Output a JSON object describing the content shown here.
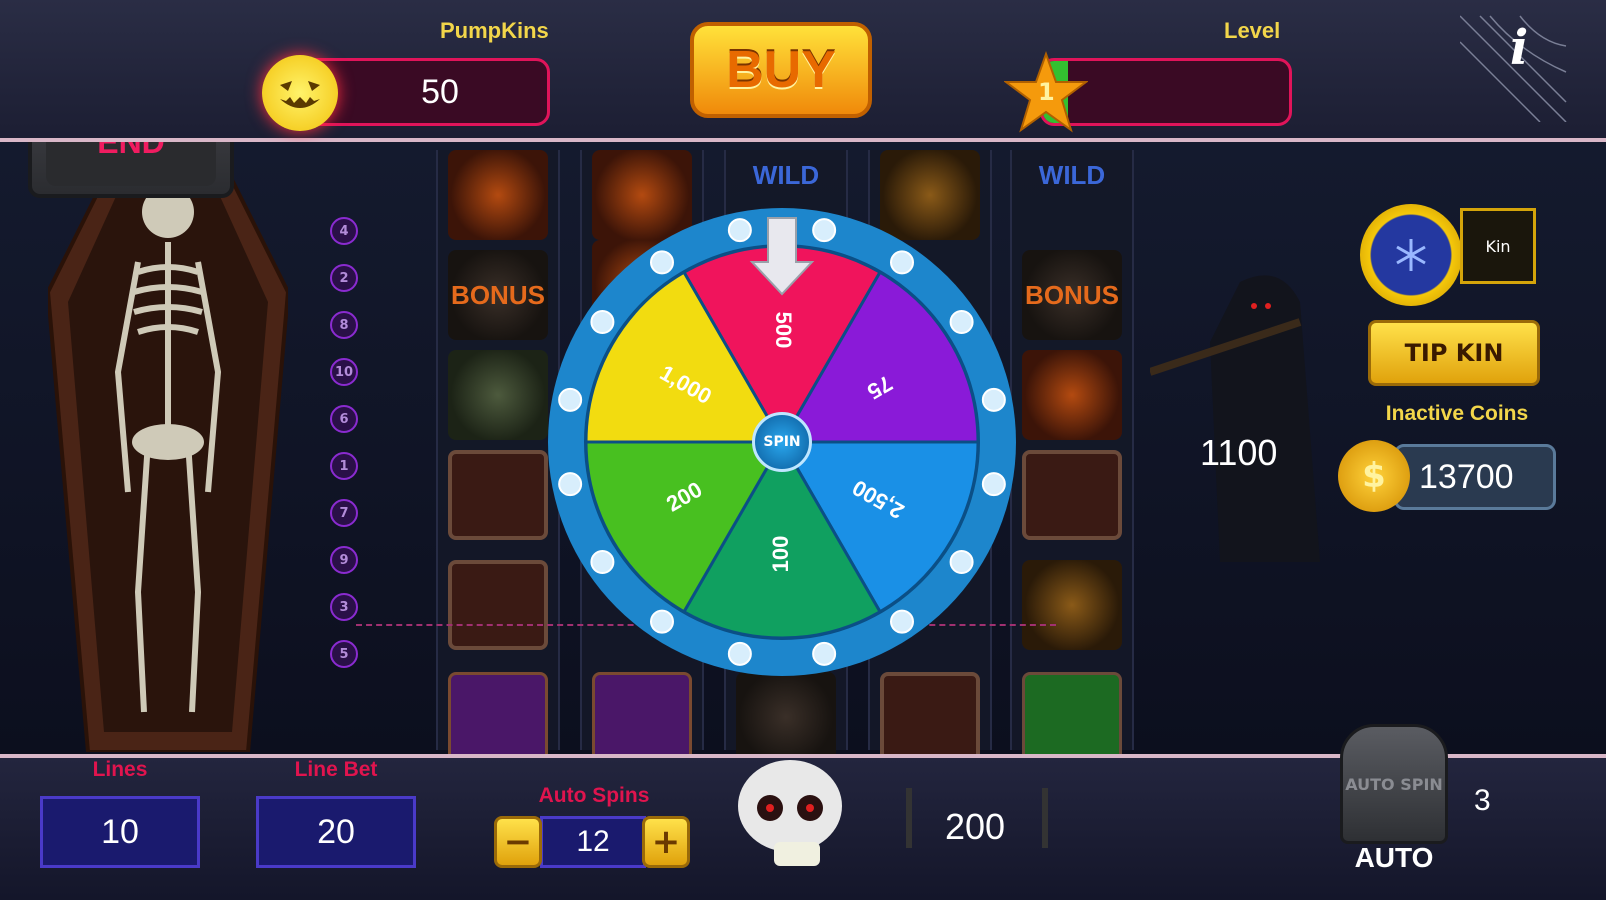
{
  "header": {
    "pumpkins_label": "PumpKins",
    "pumpkins_value": "50",
    "buy_label": "BUY",
    "level_label": "Level",
    "level_value": "1",
    "level_progress": 0.1,
    "info_label": "i",
    "end_label": "END"
  },
  "reels": {
    "wild_label": "WILD",
    "bonus_label": "BONUS",
    "line_numbers": [
      "4",
      "2",
      "8",
      "10",
      "6",
      "1",
      "7",
      "9",
      "3",
      "5"
    ]
  },
  "wheel": {
    "spin_label": "SPIN",
    "segments": [
      "500",
      "75",
      "2,500",
      "100",
      "200",
      "1,000"
    ],
    "colors": [
      "#f0145c",
      "#8a1ad8",
      "#1a90e6",
      "#10a060",
      "#48c020",
      "#f2dc10"
    ]
  },
  "side": {
    "kin_label": "Kin",
    "tip_label": "TIP KIN",
    "inactive_label": "Inactive Coins",
    "inactive_value": "13700",
    "floating_value": "1100"
  },
  "bottom": {
    "lines_label": "Lines",
    "lines_value": "10",
    "linebet_label": "Line Bet",
    "linebet_value": "20",
    "autospins_label": "Auto Spins",
    "autospins_value": "12",
    "minus_label": "−",
    "plus_label": "+",
    "total_bet": "200",
    "auto_label": "AUTO",
    "auto_count": "3",
    "tomb_text": "AUTO SPIN"
  }
}
